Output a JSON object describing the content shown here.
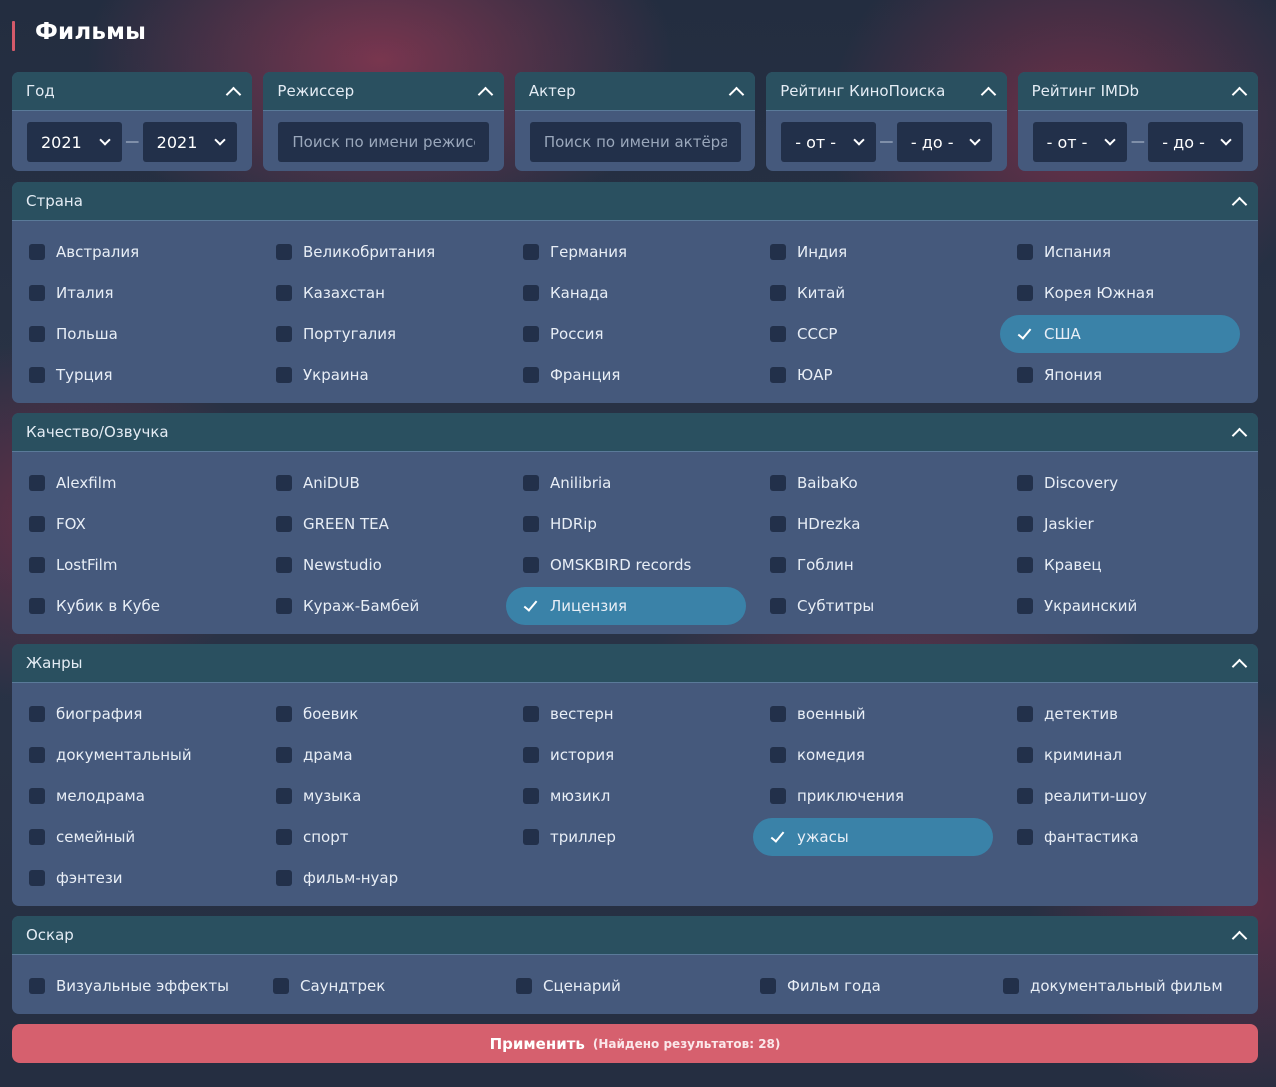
{
  "page_title": "Фильмы",
  "colors": {
    "accent": "#d45a6a",
    "panel": "#45597c",
    "header": "#2a5060",
    "selected": "#3a82a8",
    "apply": "#d6606e"
  },
  "filters": {
    "year": {
      "label": "Год",
      "from": "2021",
      "to": "2021",
      "separator": "—"
    },
    "director": {
      "label": "Режиссер",
      "placeholder": "Поиск по имени режиссера"
    },
    "actor": {
      "label": "Актер",
      "placeholder": "Поиск по имени актёра"
    },
    "kp_rating": {
      "label": "Рейтинг КиноПоиска",
      "from": "- от -",
      "to": "- до -",
      "separator": "—"
    },
    "imdb_rating": {
      "label": "Рейтинг IMDb",
      "from": "- от -",
      "to": "- до -",
      "separator": "—"
    }
  },
  "sections": [
    {
      "key": "country",
      "title": "Страна",
      "items": [
        {
          "label": "Австралия",
          "checked": false
        },
        {
          "label": "Великобритания",
          "checked": false
        },
        {
          "label": "Германия",
          "checked": false
        },
        {
          "label": "Индия",
          "checked": false
        },
        {
          "label": "Испания",
          "checked": false
        },
        {
          "label": "Италия",
          "checked": false
        },
        {
          "label": "Казахстан",
          "checked": false
        },
        {
          "label": "Канада",
          "checked": false
        },
        {
          "label": "Китай",
          "checked": false
        },
        {
          "label": "Корея Южная",
          "checked": false
        },
        {
          "label": "Польша",
          "checked": false
        },
        {
          "label": "Португалия",
          "checked": false
        },
        {
          "label": "Россия",
          "checked": false
        },
        {
          "label": "СССР",
          "checked": false
        },
        {
          "label": "США",
          "checked": true
        },
        {
          "label": "Турция",
          "checked": false
        },
        {
          "label": "Украина",
          "checked": false
        },
        {
          "label": "Франция",
          "checked": false
        },
        {
          "label": "ЮАР",
          "checked": false
        },
        {
          "label": "Япония",
          "checked": false
        }
      ]
    },
    {
      "key": "quality",
      "title": "Качество/Озвучка",
      "items": [
        {
          "label": "Alexfilm",
          "checked": false
        },
        {
          "label": "AniDUB",
          "checked": false
        },
        {
          "label": "Anilibria",
          "checked": false
        },
        {
          "label": "BaibaKo",
          "checked": false
        },
        {
          "label": "Discovery",
          "checked": false
        },
        {
          "label": "FOX",
          "checked": false
        },
        {
          "label": "GREEN TEA",
          "checked": false
        },
        {
          "label": "HDRip",
          "checked": false
        },
        {
          "label": "HDrezka",
          "checked": false
        },
        {
          "label": "Jaskier",
          "checked": false
        },
        {
          "label": "LostFilm",
          "checked": false
        },
        {
          "label": "Newstudio",
          "checked": false
        },
        {
          "label": "OMSKBIRD records",
          "checked": false
        },
        {
          "label": "Гоблин",
          "checked": false
        },
        {
          "label": "Кравец",
          "checked": false
        },
        {
          "label": "Кубик в Кубе",
          "checked": false
        },
        {
          "label": "Кураж-Бамбей",
          "checked": false
        },
        {
          "label": "Лицензия",
          "checked": true
        },
        {
          "label": "Субтитры",
          "checked": false
        },
        {
          "label": "Украинский",
          "checked": false
        }
      ]
    },
    {
      "key": "genres",
      "title": "Жанры",
      "items": [
        {
          "label": "биография",
          "checked": false
        },
        {
          "label": "боевик",
          "checked": false
        },
        {
          "label": "вестерн",
          "checked": false
        },
        {
          "label": "военный",
          "checked": false
        },
        {
          "label": "детектив",
          "checked": false
        },
        {
          "label": "документальный",
          "checked": false
        },
        {
          "label": "драма",
          "checked": false
        },
        {
          "label": "история",
          "checked": false
        },
        {
          "label": "комедия",
          "checked": false
        },
        {
          "label": "криминал",
          "checked": false
        },
        {
          "label": "мелодрама",
          "checked": false
        },
        {
          "label": "музыка",
          "checked": false
        },
        {
          "label": "мюзикл",
          "checked": false
        },
        {
          "label": "приключения",
          "checked": false
        },
        {
          "label": "реалити-шоу",
          "checked": false
        },
        {
          "label": "семейный",
          "checked": false
        },
        {
          "label": "спорт",
          "checked": false
        },
        {
          "label": "триллер",
          "checked": false
        },
        {
          "label": "ужасы",
          "checked": true
        },
        {
          "label": "фантастика",
          "checked": false
        },
        {
          "label": "фэнтези",
          "checked": false
        },
        {
          "label": "фильм-нуар",
          "checked": false
        }
      ]
    },
    {
      "key": "oscar",
      "title": "Оскар",
      "items": [
        {
          "label": "Визуальные эффекты",
          "checked": false
        },
        {
          "label": "Саундтрек",
          "checked": false
        },
        {
          "label": "Сценарий",
          "checked": false
        },
        {
          "label": "Фильм года",
          "checked": false
        },
        {
          "label": "документальный фильм",
          "checked": false
        }
      ]
    }
  ],
  "apply": {
    "label": "Применить",
    "results_prefix": "(Найдено результатов:",
    "results_count": "28",
    "results_suffix": ")"
  }
}
